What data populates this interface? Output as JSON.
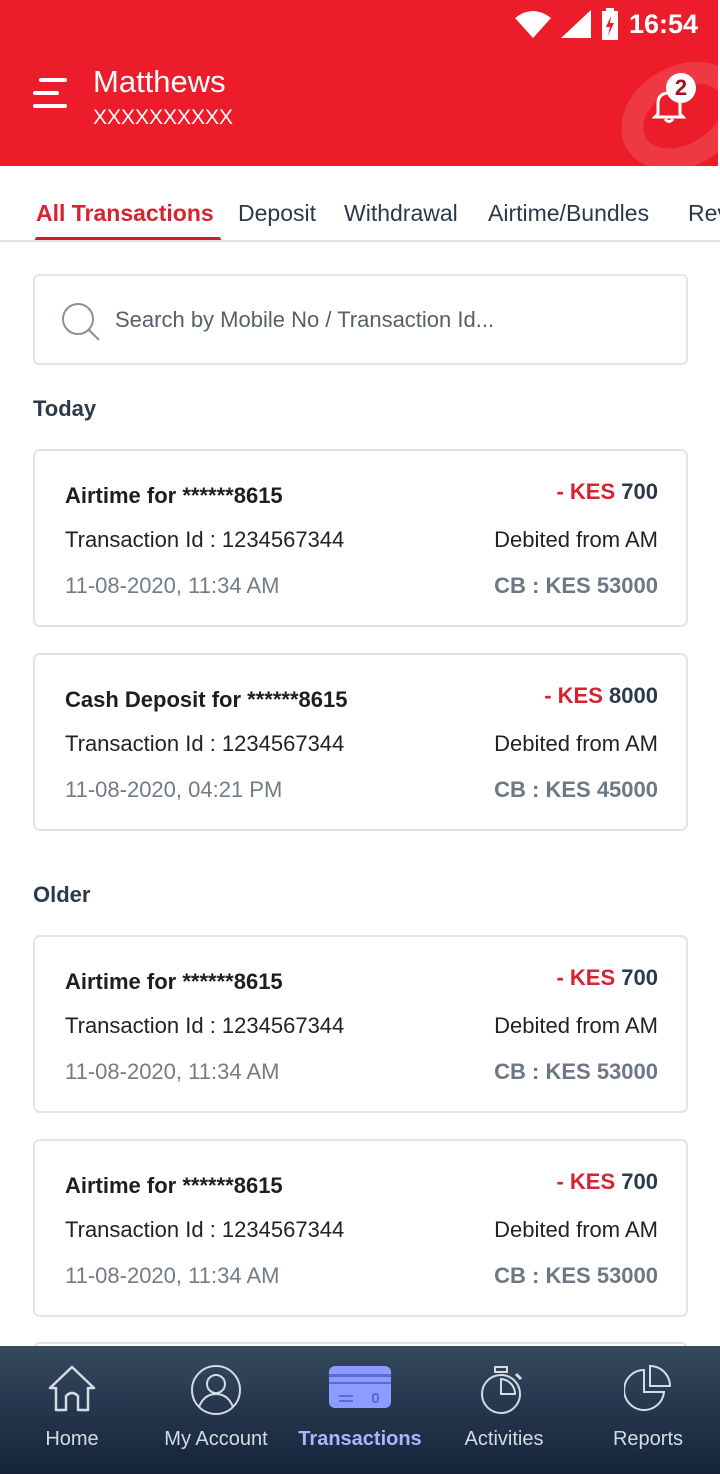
{
  "status_bar": {
    "time": "16:54"
  },
  "header": {
    "name": "Matthews",
    "masked_number": "XXXXXXXXXX",
    "notification_count": "2",
    "brand_color": "#ec1c2a"
  },
  "tabs": [
    {
      "label": "All Transactions",
      "active": true
    },
    {
      "label": "Deposit"
    },
    {
      "label": "Withdrawal"
    },
    {
      "label": "Airtime/Bundles"
    },
    {
      "label": "Rev"
    }
  ],
  "search": {
    "placeholder": "Search by Mobile No / Transaction Id...",
    "value": ""
  },
  "sections": {
    "today": "Today",
    "older": "Older"
  },
  "transactions": [
    {
      "title": "Airtime for ******8615",
      "id": "Transaction Id : 1234567344",
      "datetime": "11-08-2020, 11:34 AM",
      "sign": "- KES",
      "amount": "700",
      "source": "Debited from AM",
      "cb": "CB :  KES 53000"
    },
    {
      "title": "Cash Deposit for ******8615",
      "id": "Transaction Id : 1234567344",
      "datetime": "11-08-2020, 04:21 PM",
      "sign": "- KES",
      "amount": "8000",
      "source": "Debited from AM",
      "cb": "CB :  KES 45000"
    },
    {
      "title": "Airtime for ******8615",
      "id": "Transaction Id : 1234567344",
      "datetime": "11-08-2020, 11:34 AM",
      "sign": "- KES",
      "amount": "700",
      "source": "Debited from AM",
      "cb": "CB :  KES 53000"
    },
    {
      "title": "Airtime for ******8615",
      "id": "Transaction Id : 1234567344",
      "datetime": "11-08-2020, 11:34 AM",
      "sign": "- KES",
      "amount": "700",
      "source": "Debited from AM",
      "cb": "CB :  KES 53000"
    }
  ],
  "bottom_nav": [
    {
      "label": "Home",
      "icon": "home-icon"
    },
    {
      "label": "My Account",
      "icon": "user-icon"
    },
    {
      "label": "Transactions",
      "icon": "card-icon",
      "active": true
    },
    {
      "label": "Activities",
      "icon": "stopwatch-icon"
    },
    {
      "label": "Reports",
      "icon": "pie-chart-icon"
    }
  ]
}
